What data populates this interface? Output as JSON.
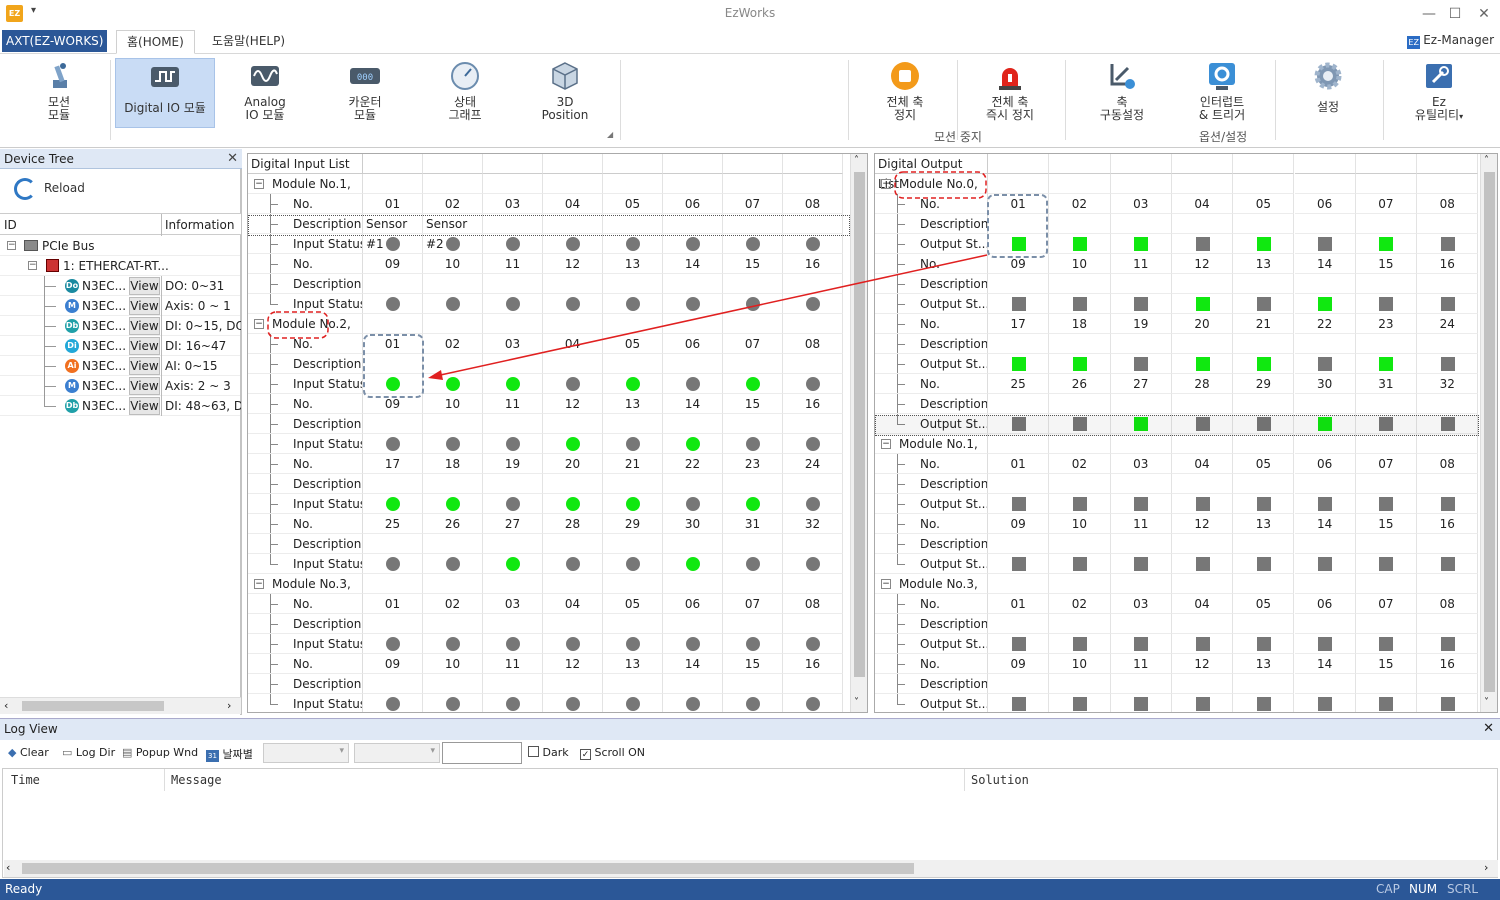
{
  "window": {
    "title": "EzWorks",
    "app_icon": "EZ",
    "min": "—",
    "max": "☐",
    "close": "✕"
  },
  "tabs": {
    "app": "AXT(EZ-WORKS)",
    "home": "홈(HOME)",
    "help": "도움말(HELP)",
    "ez_manager": "Ez-Manager"
  },
  "ribbon": {
    "motion": [
      "모션",
      "모듈"
    ],
    "dio": "Digital IO 모듈",
    "analog": [
      "Analog",
      "IO 모듈"
    ],
    "counter": [
      "카운터",
      "모듈"
    ],
    "graph": [
      "상태",
      "그래프"
    ],
    "pos3d": [
      "3D",
      "Position"
    ],
    "stop_all": [
      "전체 축",
      "정지"
    ],
    "estop_all": [
      "전체 축",
      "즉시 정지"
    ],
    "axis_cfg": [
      "축",
      "구동설정"
    ],
    "interrupt": [
      "인터럽트",
      "& 트리거"
    ],
    "settings": "설정",
    "ez_util": [
      "Ez",
      "유틸리티"
    ],
    "group_motion_stop": "모션 중지",
    "group_options": "옵션/설정"
  },
  "device_tree": {
    "title": "Device Tree",
    "reload": "Reload",
    "col_id": "ID",
    "col_info": "Information",
    "root": "PCIe Bus",
    "node": "1: ETHERCAT-RT...",
    "modules": [
      {
        "icon": "Do",
        "name": "N3EC...",
        "view": "View",
        "info": "DO: 0~31"
      },
      {
        "icon": "M",
        "name": "N3EC...",
        "view": "View",
        "info": "Axis: 0 ~ 1"
      },
      {
        "icon": "Db",
        "name": "N3EC...",
        "view": "View",
        "info": "DI: 0~15, DO:"
      },
      {
        "icon": "Di",
        "name": "N3EC...",
        "view": "View",
        "info": "DI: 16~47"
      },
      {
        "icon": "Ai",
        "name": "N3EC...",
        "view": "View",
        "info": "AI: 0~15"
      },
      {
        "icon": "M",
        "name": "N3EC...",
        "view": "View",
        "info": "Axis: 2 ~ 3"
      },
      {
        "icon": "Db",
        "name": "N3EC...",
        "view": "View",
        "info": "DI: 48~63, DO"
      }
    ]
  },
  "labels": {
    "no": "No.",
    "desc": "Description.",
    "in_status": "Input Status.",
    "out_status": "Output St..."
  },
  "digital_input": {
    "title": "Digital Input List",
    "modules": [
      {
        "name": "Module No.1,",
        "desc": [
          "Sensor #1",
          "Sensor #2"
        ],
        "rows": [
          {
            "nums": [
              "01",
              "02",
              "03",
              "04",
              "05",
              "06",
              "07",
              "08"
            ],
            "states": [
              0,
              0,
              0,
              0,
              0,
              0,
              0,
              0
            ]
          },
          {
            "nums": [
              "09",
              "10",
              "11",
              "12",
              "13",
              "14",
              "15",
              "16"
            ],
            "states": [
              0,
              0,
              0,
              0,
              0,
              0,
              0,
              0
            ]
          }
        ]
      },
      {
        "name": "Module No.2,",
        "desc": [],
        "rows": [
          {
            "nums": [
              "01",
              "02",
              "03",
              "04",
              "05",
              "06",
              "07",
              "08"
            ],
            "states": [
              1,
              1,
              1,
              0,
              1,
              0,
              1,
              0
            ]
          },
          {
            "nums": [
              "09",
              "10",
              "11",
              "12",
              "13",
              "14",
              "15",
              "16"
            ],
            "states": [
              0,
              0,
              0,
              1,
              0,
              1,
              0,
              0
            ]
          },
          {
            "nums": [
              "17",
              "18",
              "19",
              "20",
              "21",
              "22",
              "23",
              "24"
            ],
            "states": [
              1,
              1,
              0,
              1,
              1,
              0,
              1,
              0
            ]
          },
          {
            "nums": [
              "25",
              "26",
              "27",
              "28",
              "29",
              "30",
              "31",
              "32"
            ],
            "states": [
              0,
              0,
              1,
              0,
              0,
              1,
              0,
              0
            ]
          }
        ]
      },
      {
        "name": "Module No.3,",
        "desc": [],
        "rows": [
          {
            "nums": [
              "01",
              "02",
              "03",
              "04",
              "05",
              "06",
              "07",
              "08"
            ],
            "states": [
              0,
              0,
              0,
              0,
              0,
              0,
              0,
              0
            ]
          },
          {
            "nums": [
              "09",
              "10",
              "11",
              "12",
              "13",
              "14",
              "15",
              "16"
            ],
            "states": [
              0,
              0,
              0,
              0,
              0,
              0,
              0,
              0
            ]
          }
        ]
      }
    ]
  },
  "digital_output": {
    "title": "Digital Output List",
    "modules": [
      {
        "name": "Module No.0,",
        "rows": [
          {
            "nums": [
              "01",
              "02",
              "03",
              "04",
              "05",
              "06",
              "07",
              "08"
            ],
            "states": [
              1,
              1,
              1,
              0,
              1,
              0,
              1,
              0
            ]
          },
          {
            "nums": [
              "09",
              "10",
              "11",
              "12",
              "13",
              "14",
              "15",
              "16"
            ],
            "states": [
              0,
              0,
              0,
              1,
              0,
              1,
              0,
              0
            ]
          },
          {
            "nums": [
              "17",
              "18",
              "19",
              "20",
              "21",
              "22",
              "23",
              "24"
            ],
            "states": [
              1,
              1,
              0,
              1,
              1,
              0,
              1,
              0
            ]
          },
          {
            "nums": [
              "25",
              "26",
              "27",
              "28",
              "29",
              "30",
              "31",
              "32"
            ],
            "states": [
              0,
              0,
              1,
              0,
              0,
              1,
              0,
              0
            ]
          }
        ]
      },
      {
        "name": "Module No.1,",
        "rows": [
          {
            "nums": [
              "01",
              "02",
              "03",
              "04",
              "05",
              "06",
              "07",
              "08"
            ],
            "states": [
              0,
              0,
              0,
              0,
              0,
              0,
              0,
              0
            ]
          },
          {
            "nums": [
              "09",
              "10",
              "11",
              "12",
              "13",
              "14",
              "15",
              "16"
            ],
            "states": [
              0,
              0,
              0,
              0,
              0,
              0,
              0,
              0
            ]
          }
        ]
      },
      {
        "name": "Module No.3,",
        "rows": [
          {
            "nums": [
              "01",
              "02",
              "03",
              "04",
              "05",
              "06",
              "07",
              "08"
            ],
            "states": [
              0,
              0,
              0,
              0,
              0,
              0,
              0,
              0
            ]
          },
          {
            "nums": [
              "09",
              "10",
              "11",
              "12",
              "13",
              "14",
              "15",
              "16"
            ],
            "states": [
              0,
              0,
              0,
              0,
              0,
              0,
              0,
              0
            ]
          }
        ]
      }
    ]
  },
  "log": {
    "title": "Log View",
    "clear": "Clear",
    "log_dir": "Log Dir",
    "popup": "Popup Wnd",
    "date": "날짜별",
    "dark": "Dark",
    "scroll_on": "Scroll ON",
    "scroll_checked": true,
    "dark_checked": false,
    "col_time": "Time",
    "col_message": "Message",
    "col_solution": "Solution"
  },
  "status": {
    "text": "Ready",
    "cap": "CAP",
    "num": "NUM",
    "scrl": "SCRL"
  },
  "colors": {
    "on": "#10e810",
    "off": "#777777",
    "accent": "#2b5797",
    "annotation": "#e02020"
  }
}
